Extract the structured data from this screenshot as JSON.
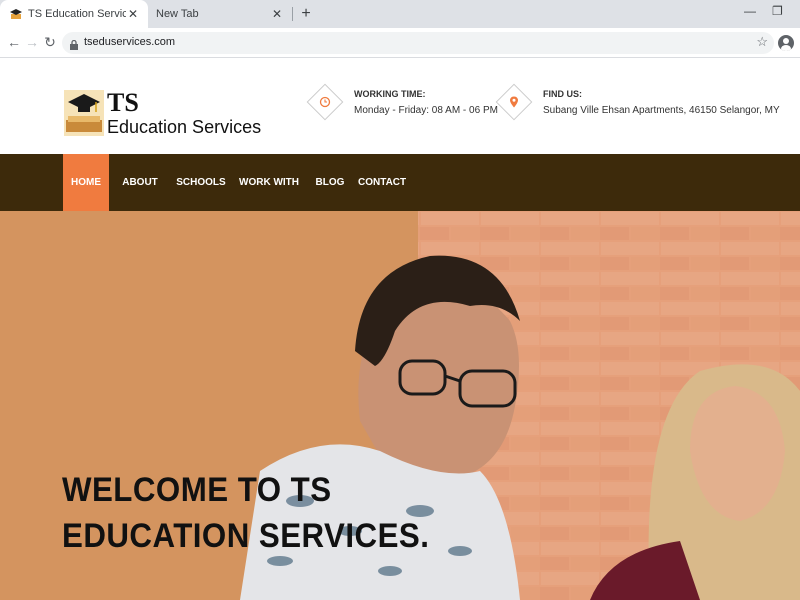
{
  "browser": {
    "tabs": [
      {
        "title": "TS Education Services",
        "active": true
      },
      {
        "title": "New Tab",
        "active": false
      }
    ],
    "url": "tseduservices.com"
  },
  "site": {
    "logo": {
      "title": "TS",
      "subtitle": "Education Services"
    },
    "working_time": {
      "label": "WORKING TIME:",
      "value": "Monday - Friday: 08 AM - 06 PM",
      "icon": "clock-icon"
    },
    "find_us": {
      "label": "FIND US:",
      "value": "Subang Ville Ehsan Apartments, 46150 Selangor, MY",
      "icon": "location-pin-icon"
    },
    "nav": [
      {
        "label": "HOME",
        "active": true
      },
      {
        "label": "ABOUT US"
      },
      {
        "label": "SCHOOLS"
      },
      {
        "label": "WORK WITH US"
      },
      {
        "label": "BLOG"
      },
      {
        "label": "CONTACT"
      }
    ],
    "hero": {
      "title": "WELCOME TO TS EDUCATION SERVICES."
    },
    "colors": {
      "nav_bg": "#3d2a0b",
      "accent": "#f07b3f",
      "hero_bg": "#d4945f"
    }
  }
}
